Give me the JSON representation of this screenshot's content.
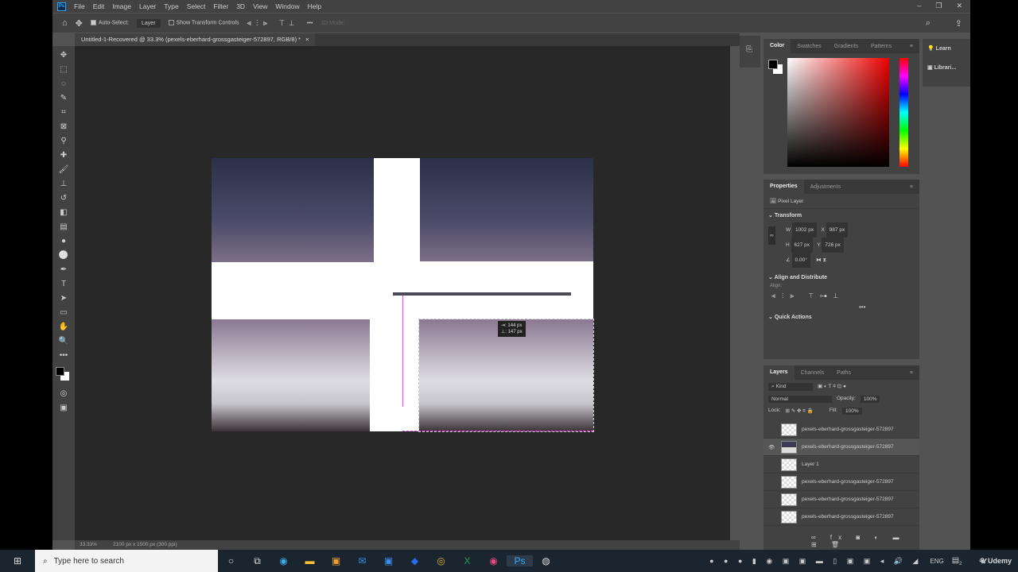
{
  "menu": [
    "File",
    "Edit",
    "Image",
    "Layer",
    "Type",
    "Select",
    "Filter",
    "3D",
    "View",
    "Window",
    "Help"
  ],
  "options": {
    "auto_select": "Auto-Select:",
    "layer_select": "Layer",
    "show_transform": "Show Transform Controls",
    "mode_3d": "3D Mode:"
  },
  "doc_tab": "Untitled-1-Recovered @ 33.3% (pexels-eberhard-grossgasteiger-572897, RGB/8) *",
  "status": {
    "zoom": "33.33%",
    "size": "2100 px x 1500 px (300 ppi)"
  },
  "measure": {
    "dx": "144 px",
    "dy": "147 px"
  },
  "color_panel": {
    "tabs": [
      "Color",
      "Swatches",
      "Gradients",
      "Patterns"
    ]
  },
  "side": {
    "learn": "Learn",
    "libraries": "Librari..."
  },
  "properties": {
    "tabs": [
      "Properties",
      "Adjustments"
    ],
    "kind": "Pixel Layer",
    "transform": "Transform",
    "w_label": "W",
    "w": "1002 px",
    "x_label": "X",
    "x": "987 px",
    "h_label": "H",
    "h": "627 px",
    "y_label": "Y",
    "y": "726 px",
    "angle": "0.00°",
    "align_distribute": "Align and Distribute",
    "align": "Align:",
    "quick_actions": "Quick Actions"
  },
  "layers": {
    "tabs": [
      "Layers",
      "Channels",
      "Paths"
    ],
    "kind": "Kind",
    "blend": "Normal",
    "opacity_label": "Opacity:",
    "opacity": "100%",
    "lock": "Lock:",
    "fill_label": "Fill:",
    "fill": "100%",
    "items": [
      {
        "name": "pexels-eberhard-grossgasteiger-572897",
        "visible": false
      },
      {
        "name": "pexels-eberhard-grossgasteiger-572897",
        "visible": true
      },
      {
        "name": "Layer 1",
        "visible": false
      },
      {
        "name": "pexels-eberhard-grossgasteiger-572897",
        "visible": false
      },
      {
        "name": "pexels-eberhard-grossgasteiger-572897",
        "visible": false
      },
      {
        "name": "pexels-eberhard-grossgasteiger-572897",
        "visible": false
      }
    ]
  },
  "taskbar": {
    "search_placeholder": "Type here to search",
    "lang": "ENG",
    "notif": "2",
    "brand": "Udemy"
  }
}
